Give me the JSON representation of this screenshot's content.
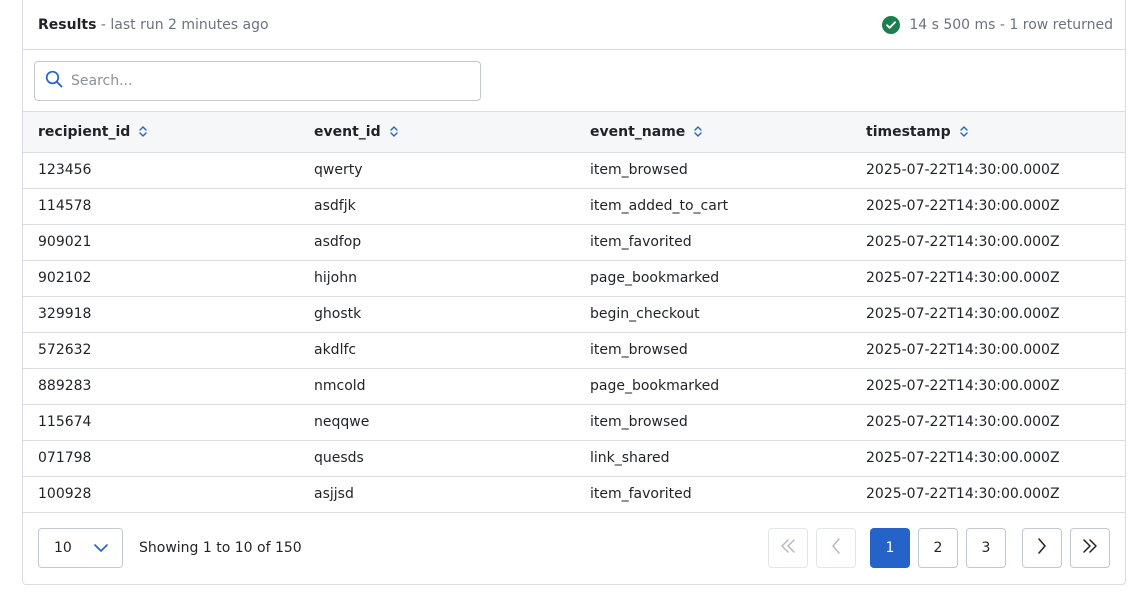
{
  "header": {
    "title": "Results",
    "separator": "-",
    "subtitle": "last run 2 minutes ago",
    "status": "14 s 500 ms - 1 row returned",
    "status_icon": "check-circle-icon",
    "status_color": "#1a7f4b"
  },
  "search": {
    "placeholder": "Search...",
    "value": ""
  },
  "table": {
    "columns": [
      "recipient_id",
      "event_id",
      "event_name",
      "timestamp"
    ],
    "rows": [
      [
        "123456",
        "qwerty",
        "item_browsed",
        "2025-07-22T14:30:00.000Z"
      ],
      [
        "114578",
        "asdfjk",
        "item_added_to_cart",
        "2025-07-22T14:30:00.000Z"
      ],
      [
        "909021",
        "asdfop",
        "item_favorited",
        "2025-07-22T14:30:00.000Z"
      ],
      [
        "902102",
        "hijohn",
        "page_bookmarked",
        "2025-07-22T14:30:00.000Z"
      ],
      [
        "329918",
        "ghostk",
        "begin_checkout",
        "2025-07-22T14:30:00.000Z"
      ],
      [
        "572632",
        "akdlfc",
        "item_browsed",
        "2025-07-22T14:30:00.000Z"
      ],
      [
        "889283",
        "nmcold",
        "page_bookmarked",
        "2025-07-22T14:30:00.000Z"
      ],
      [
        "115674",
        "neqqwe",
        "item_browsed",
        "2025-07-22T14:30:00.000Z"
      ],
      [
        "071798",
        "quesds",
        "link_shared",
        "2025-07-22T14:30:00.000Z"
      ],
      [
        "100928",
        "asjjsd",
        "item_favorited",
        "2025-07-22T14:30:00.000Z"
      ]
    ]
  },
  "footer": {
    "page_size": "10",
    "showing": "Showing 1 to 10 of 150",
    "pages": [
      "1",
      "2",
      "3"
    ],
    "current_page": "1",
    "accent_color": "#2563c9"
  }
}
